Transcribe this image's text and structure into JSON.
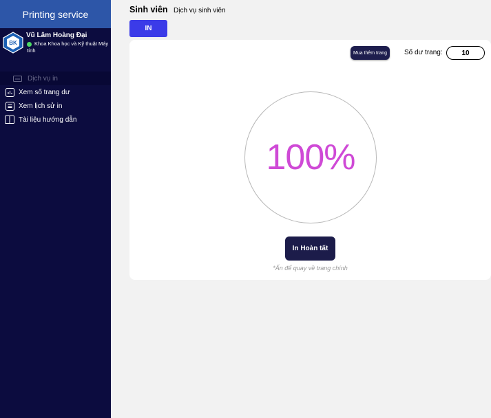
{
  "sidebar": {
    "brand": "Printing service",
    "user": {
      "name": "Vũ Lâm Hoàng Đại",
      "faculty": "Khoa Khoa học và Kỹ thuật Máy tính",
      "status_color": "#4cd964"
    },
    "items": [
      {
        "label": "Dịch vụ in",
        "icon": "printer-icon",
        "active": true
      },
      {
        "label": "Xem số trang dư",
        "icon": "bar-chart-icon"
      },
      {
        "label": "Xem lịch sử in",
        "icon": "document-list-icon"
      },
      {
        "label": "Tài liệu hướng dẫn",
        "icon": "book-icon"
      }
    ]
  },
  "header": {
    "title": "Sinh viên",
    "subtitle": "Dịch vụ sinh viên",
    "tab_label": "IN"
  },
  "main": {
    "buy_button": "Mua thêm trang",
    "balance_label": "Số dư trang:",
    "balance_value": "10",
    "progress_text": "100%",
    "progress_fraction": 1.0,
    "done_button": "In Hoàn tất",
    "hint": "*Ấn để quay về trang chính"
  },
  "colors": {
    "sidebar_bg": "#0c0c3f",
    "brand_bg": "#2d56a8",
    "accent": "#3b3be8",
    "progress_text": "#cf4ad6"
  }
}
